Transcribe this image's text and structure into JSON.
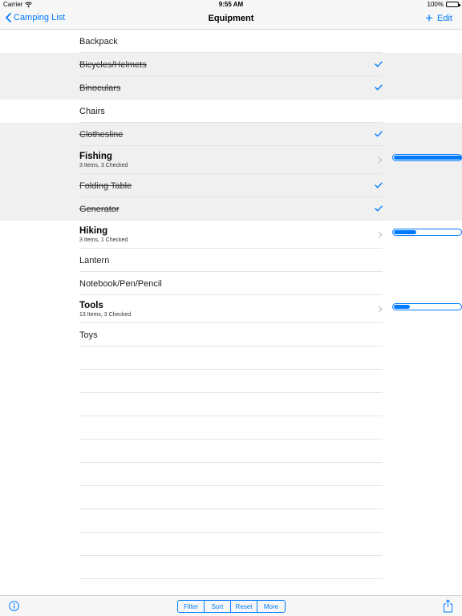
{
  "status": {
    "carrier": "Carrier",
    "time": "9:55 AM",
    "battery": "100%"
  },
  "nav": {
    "back_label": "Camping List",
    "title": "Equipment",
    "add_label": "+",
    "edit_label": "Edit"
  },
  "colors": {
    "accent": "#007aff",
    "checked_row_bg": "#f0f0f0"
  },
  "items": [
    {
      "label": "Backpack",
      "checked": false
    },
    {
      "label": "Bicycles/Helmets",
      "checked": true
    },
    {
      "label": "Binoculars",
      "checked": true
    },
    {
      "label": "Chairs",
      "checked": false
    },
    {
      "label": "Clothesline",
      "checked": true
    },
    {
      "label": "Fishing",
      "group": true,
      "subtitle": "3 Items, 3 Checked",
      "progress": 1.0
    },
    {
      "label": "Folding Table",
      "checked": true
    },
    {
      "label": "Generator",
      "checked": true
    },
    {
      "label": "Hiking",
      "group": true,
      "subtitle": "3 Items, 1 Checked",
      "progress": 0.33
    },
    {
      "label": "Lantern",
      "checked": false
    },
    {
      "label": "Notebook/Pen/Pencil",
      "checked": false
    },
    {
      "label": "Tools",
      "group": true,
      "subtitle": "13 Items, 3 Checked",
      "progress": 0.23
    },
    {
      "label": "Toys",
      "checked": false
    }
  ],
  "toolbar": {
    "segments": [
      "Filter",
      "Sort",
      "Reset",
      "More"
    ],
    "info_icon": "info-icon",
    "share_icon": "share-icon"
  }
}
